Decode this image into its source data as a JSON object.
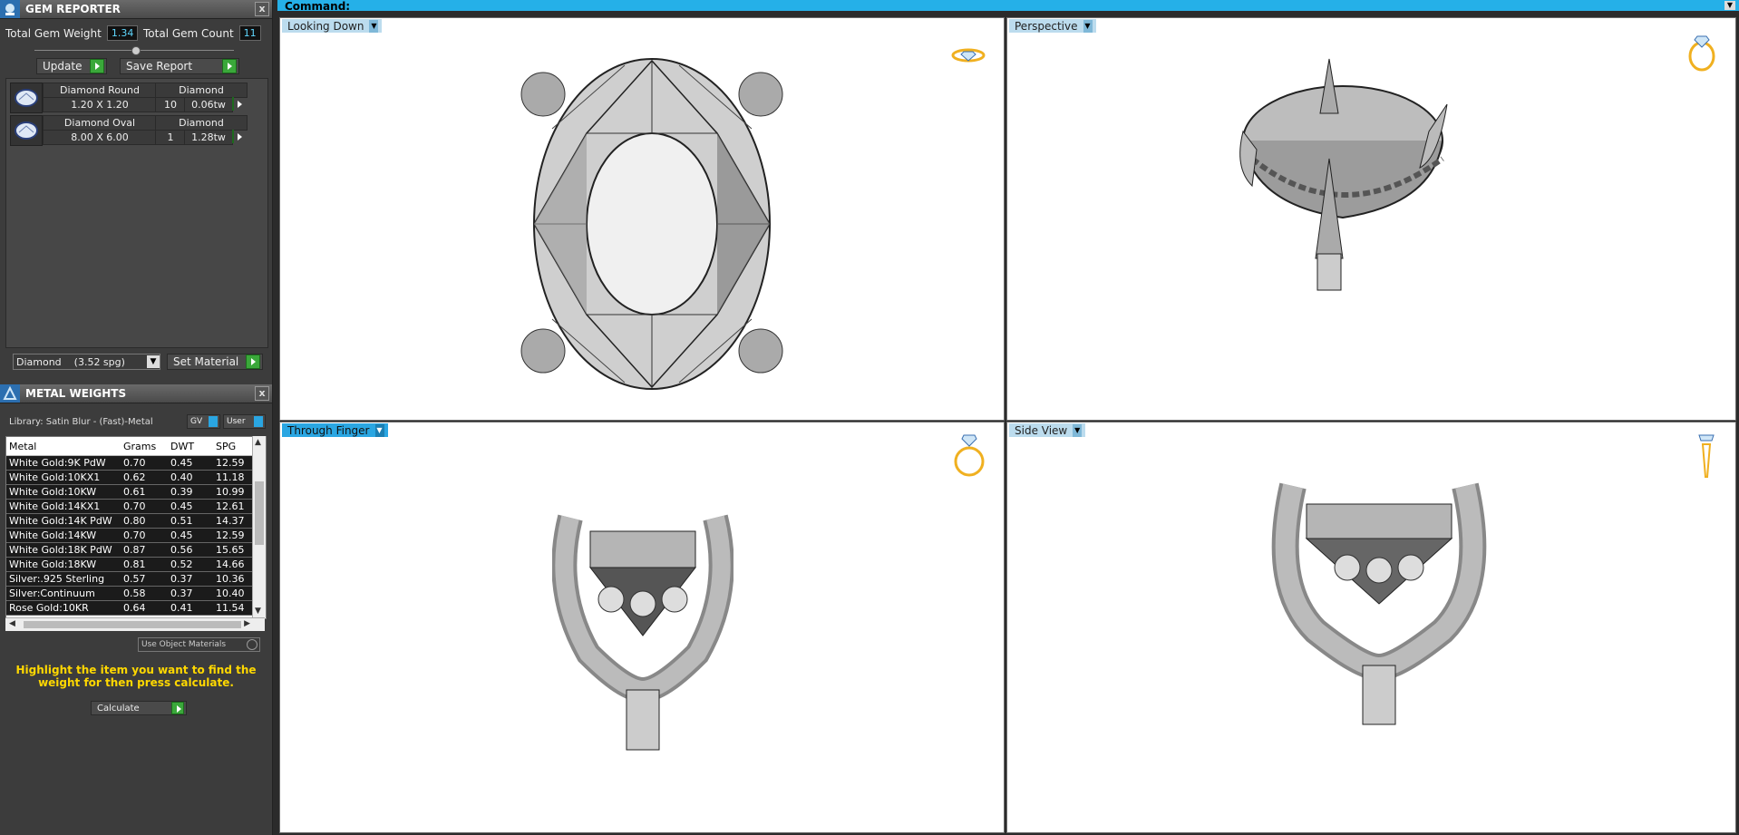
{
  "gem_reporter": {
    "title": "GEM REPORTER",
    "close": "x",
    "total_weight_label": "Total Gem Weight",
    "total_weight_value": "1.34",
    "total_count_label": "Total Gem Count",
    "total_count_value": "11",
    "update_label": "Update",
    "save_report_label": "Save Report",
    "gems": [
      {
        "name": "Diamond Round",
        "material": "Diamond",
        "size": "1.20 X 1.20",
        "count": "10",
        "weight": "0.06tw"
      },
      {
        "name": "Diamond Oval",
        "material": "Diamond",
        "size": "8.00 X 6.00",
        "count": "1",
        "weight": "1.28tw"
      }
    ],
    "material_select": "Diamond    (3.52 spg)",
    "set_material_label": "Set Material"
  },
  "metal_weights": {
    "title": "METAL WEIGHTS",
    "close": "x",
    "library_label": "Library: Satin Blur - (Fast)-Metal",
    "gv_label": "GV",
    "user_label": "User",
    "columns": [
      "Metal",
      "Grams",
      "DWT",
      "SPG"
    ],
    "rows": [
      [
        "White Gold:9K PdW",
        "0.70",
        "0.45",
        "12.59"
      ],
      [
        "White Gold:10KX1",
        "0.62",
        "0.40",
        "11.18"
      ],
      [
        "White Gold:10KW",
        "0.61",
        "0.39",
        "10.99"
      ],
      [
        "White Gold:14KX1",
        "0.70",
        "0.45",
        "12.61"
      ],
      [
        "White Gold:14K PdW",
        "0.80",
        "0.51",
        "14.37"
      ],
      [
        "White Gold:14KW",
        "0.70",
        "0.45",
        "12.59"
      ],
      [
        "White Gold:18K PdW",
        "0.87",
        "0.56",
        "15.65"
      ],
      [
        "White Gold:18KW",
        "0.81",
        "0.52",
        "14.66"
      ],
      [
        "Silver:.925 Sterling",
        "0.57",
        "0.37",
        "10.36"
      ],
      [
        "Silver:Continuum",
        "0.58",
        "0.37",
        "10.40"
      ],
      [
        "Rose Gold:10KR",
        "0.64",
        "0.41",
        "11.54"
      ]
    ],
    "use_object_materials": "Use Object Materials",
    "hint": "Highlight the item you want to find the weight for then press calculate.",
    "calculate_label": "Calculate"
  },
  "command_bar": {
    "label": "Command:"
  },
  "viewports": [
    {
      "label": "Looking Down",
      "active": false
    },
    {
      "label": "Perspective",
      "active": false
    },
    {
      "label": "Through Finger",
      "active": true
    },
    {
      "label": "Side View",
      "active": false
    }
  ],
  "colors": {
    "accent": "#2aa6e2",
    "hint_text": "#ffd800",
    "value_text": "#5fd8ff",
    "gem_icon": "#f0b020"
  }
}
